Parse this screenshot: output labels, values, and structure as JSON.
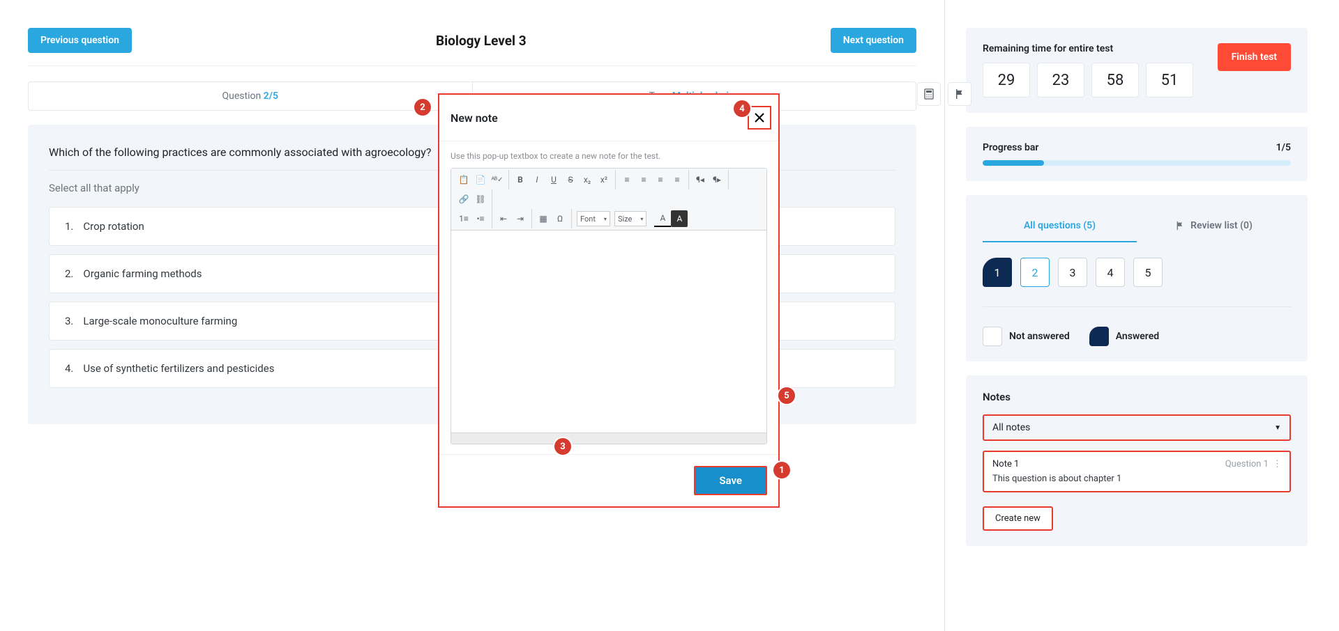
{
  "nav": {
    "prev": "Previous question",
    "next": "Next question",
    "title": "Biology Level 3"
  },
  "info": {
    "question_label": "Question ",
    "question_num": "2/5",
    "type_label": "Type ",
    "type_value": "Multiple choice"
  },
  "question": {
    "text": "Which of the following practices are commonly associated with agroecology?",
    "instr": "Select all that apply",
    "options": [
      {
        "num": "1.",
        "text": "Crop rotation"
      },
      {
        "num": "2.",
        "text": "Organic farming methods"
      },
      {
        "num": "3.",
        "text": "Large-scale monoculture farming"
      },
      {
        "num": "4.",
        "text": "Use of synthetic fertilizers and pesticides"
      }
    ]
  },
  "timer": {
    "label": "Remaining time for entire test",
    "values": [
      "29",
      "23",
      "58",
      "51"
    ],
    "finish": "Finish test"
  },
  "progress": {
    "label": "Progress bar",
    "count": "1/5",
    "percent": 20
  },
  "tabs": {
    "all": "All questions (5)",
    "review": "Review list (0)"
  },
  "qnums": [
    "1",
    "2",
    "3",
    "4",
    "5"
  ],
  "legend": {
    "not": "Not answered",
    "ans": "Answered"
  },
  "notes": {
    "title": "Notes",
    "filter": "All notes",
    "entry": {
      "title": "Note 1",
      "ref": "Question 1",
      "body": "This question is about chapter 1"
    },
    "create": "Create new"
  },
  "modal": {
    "title": "New note",
    "hint": "Use this pop-up textbox to create a new note for the test.",
    "font": "Font",
    "size": "Size",
    "save": "Save"
  },
  "anno": {
    "a1": "1",
    "a2": "2",
    "a3": "3",
    "a4": "4",
    "a5": "5"
  }
}
